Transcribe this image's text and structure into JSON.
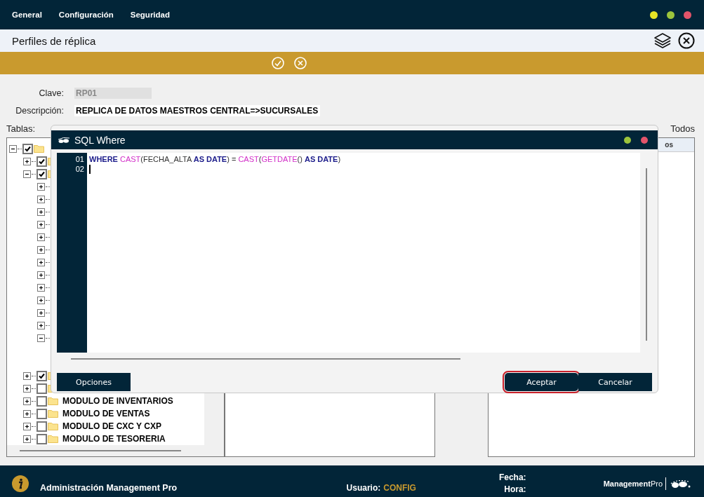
{
  "menu": [
    {
      "label": "General"
    },
    {
      "label": "Configuración"
    },
    {
      "label": "Seguridad"
    }
  ],
  "title": "Perfiles de réplica",
  "form": {
    "clave_label": "Clave:",
    "clave_value": "RP01",
    "descripcion_label": "Descripción:",
    "descripcion_value": "REPLICA DE DATOS MAESTROS CENTRAL=>SUCURSALES"
  },
  "tables_label": "Tablas:",
  "todos_label": "Todos",
  "tree": [
    {
      "checked": true,
      "expanded": true,
      "children": [
        {
          "checked": true,
          "expanded": false
        },
        {
          "checked": true,
          "expanded": true,
          "children": [
            {
              "expanded": false
            },
            {
              "expanded": false
            },
            {
              "expanded": false
            },
            {
              "expanded": false
            },
            {
              "expanded": false
            },
            {
              "expanded": false
            },
            {
              "expanded": false
            },
            {
              "expanded": false
            },
            {
              "expanded": false
            },
            {
              "expanded": false
            },
            {
              "expanded": false
            },
            {
              "expanded": false
            },
            {
              "expanded": true
            }
          ]
        },
        {
          "checked": true,
          "expanded": false
        },
        {
          "checked": false,
          "expanded": false
        },
        {
          "checked": false,
          "expanded": false,
          "label": "MODULO DE INVENTARIOS"
        },
        {
          "checked": false,
          "expanded": false,
          "label": "MODULO DE VENTAS"
        },
        {
          "checked": false,
          "expanded": false,
          "label": "MODULO DE CXC Y CXP"
        },
        {
          "checked": false,
          "expanded": false,
          "label": "MODULO DE TESORERIA"
        }
      ]
    }
  ],
  "right_panel": {
    "header": "os"
  },
  "dialog": {
    "title": "SQL Where",
    "lines": [
      {
        "number": "01",
        "tokens": [
          {
            "kind": "keyword",
            "text": "WHERE "
          },
          {
            "kind": "function",
            "text": "CAST"
          },
          {
            "kind": "plain",
            "text": "(FECHA_ALTA "
          },
          {
            "kind": "keyword",
            "text": "AS DATE"
          },
          {
            "kind": "plain",
            "text": ") = "
          },
          {
            "kind": "function",
            "text": "CAST"
          },
          {
            "kind": "plain",
            "text": "("
          },
          {
            "kind": "function",
            "text": "GETDATE"
          },
          {
            "kind": "plain",
            "text": "() "
          },
          {
            "kind": "keyword",
            "text": "AS DATE"
          },
          {
            "kind": "plain",
            "text": ")"
          }
        ]
      },
      {
        "number": "02",
        "cursor": true
      }
    ],
    "left_buttons": [
      {
        "label": "Opciones",
        "focused": false
      }
    ],
    "right_buttons": [
      {
        "label": "Aceptar",
        "focused": true
      },
      {
        "label": "Cancelar",
        "focused": false
      }
    ]
  },
  "status_bar": {
    "app": "Administración Management Pro",
    "user_label": "Usuario:",
    "user": "CONFIG",
    "date_label": "Fecha:",
    "time_label": "Hora:",
    "logo": "**Management**Pro"
  }
}
